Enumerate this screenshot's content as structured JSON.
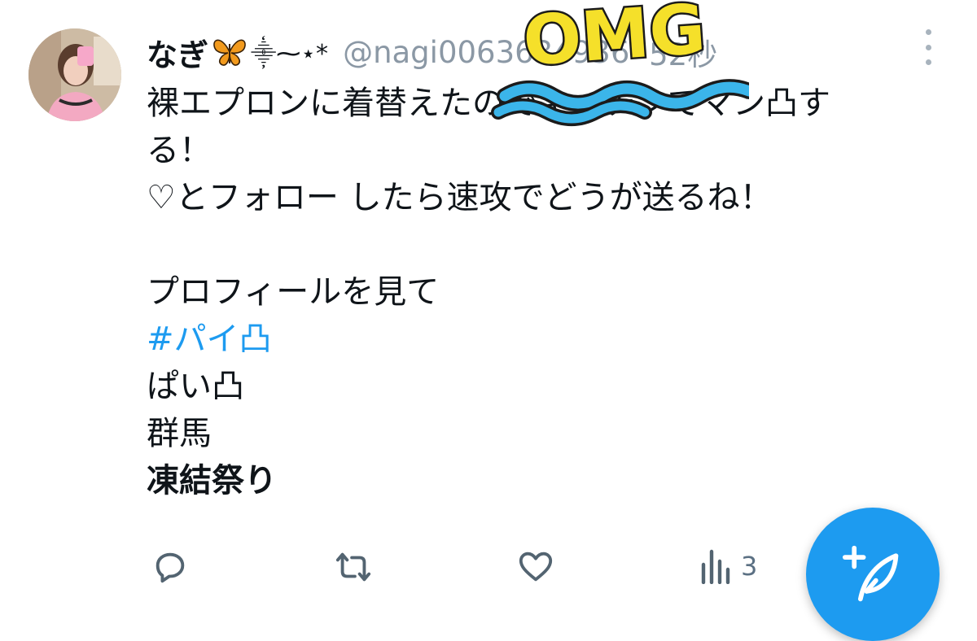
{
  "tweet": {
    "author": {
      "display_name": "なぎ",
      "name_decoration": "⸎⁓⋆*",
      "handle": "@nagi0063634936",
      "time_separator": "·",
      "time": "52秒"
    },
    "lines": [
      {
        "text": "裸エプロンに着替えたのでキッチンでマン凸す",
        "style": "normal"
      },
      {
        "text": "る！",
        "style": "normal"
      },
      {
        "text": "♡とフォロー したら速攻でどうが送るね！",
        "style": "normal"
      },
      {
        "text": "",
        "style": "spacer"
      },
      {
        "text": "プロフィールを見て",
        "style": "normal"
      },
      {
        "text": "#パイ凸",
        "style": "hashtag"
      },
      {
        "text": "ぱい凸",
        "style": "normal"
      },
      {
        "text": "群馬",
        "style": "normal"
      },
      {
        "text": "凍結祭り",
        "style": "bold"
      }
    ],
    "views_count": "3"
  },
  "stamp": {
    "text": "OMG"
  },
  "icons": [
    "avatar",
    "butterfly-icon",
    "more-icon",
    "reply-icon",
    "retweet-icon",
    "like-icon",
    "views-icon",
    "compose-icon"
  ],
  "colors": {
    "accent": "#1d9bf0",
    "secondary_text": "#8b98a5",
    "stamp_yellow": "#f5e02a",
    "stamp_squiggle": "#3bb5ea"
  }
}
